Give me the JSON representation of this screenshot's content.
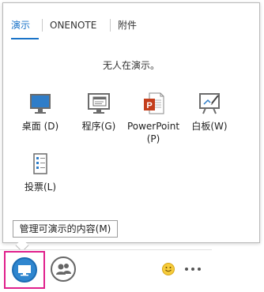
{
  "tabs": [
    {
      "label": "演示",
      "active": true
    },
    {
      "label": "ONENOTE",
      "active": false
    },
    {
      "label": "附件",
      "active": false
    }
  ],
  "status_text": "无人在演示。",
  "tiles": [
    {
      "label": "桌面 (D)",
      "icon": "desktop-icon"
    },
    {
      "label": "程序(G)",
      "icon": "program-icon"
    },
    {
      "label": "PowerPoint (P)",
      "icon": "powerpoint-icon"
    },
    {
      "label": "白板(W)",
      "icon": "whiteboard-icon"
    },
    {
      "label": "投票(L)",
      "icon": "poll-icon"
    }
  ],
  "manage_button": "管理可演示的内容(M)",
  "toolbar": {
    "present_icon": "present-monitor-icon",
    "people_icon": "people-icon",
    "emoji_icon": "smiley-icon",
    "more_icon": "more-options-icon"
  },
  "colors": {
    "accent": "#1a73c8",
    "highlight_border": "#e0208c",
    "present_blue": "#2f86cf",
    "powerpoint_red": "#c43e1c"
  }
}
